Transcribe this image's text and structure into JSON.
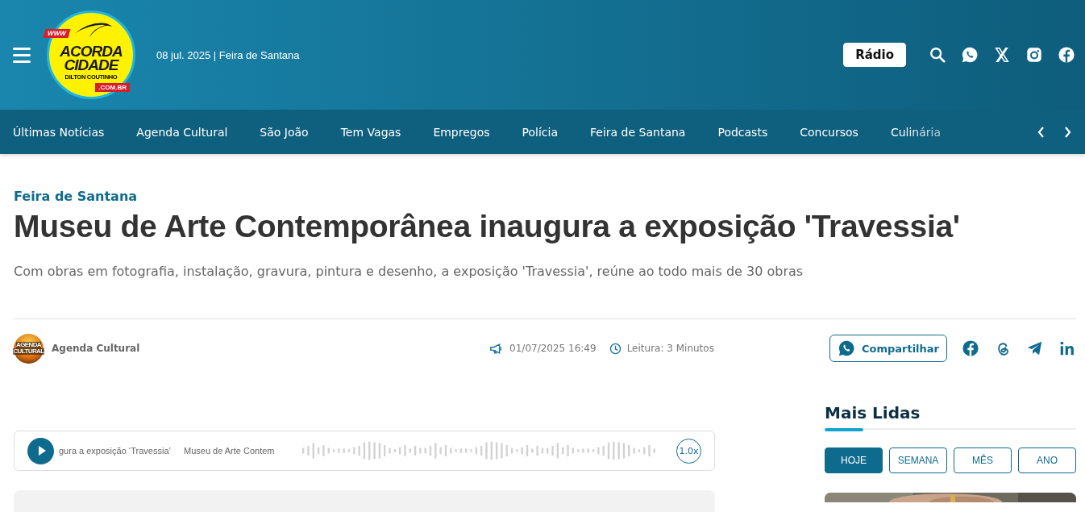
{
  "header": {
    "date_location": "08 jul. 2025 | Feira de Santana",
    "radio_button": {
      "label": "Rádio",
      "highlighted": true
    },
    "logo": {
      "www": "WWW",
      "line_1": "ACORDA",
      "line_2": "CIDADE",
      "subtitle": "DILTON COUTINHO",
      "domain": ".COM.BR"
    }
  },
  "nav": {
    "items": [
      {
        "label": "Últimas Notícias"
      },
      {
        "label": "Agenda Cultural"
      },
      {
        "label": "São João"
      },
      {
        "label": "Tem Vagas"
      },
      {
        "label": "Empregos"
      },
      {
        "label": "Polícia"
      },
      {
        "label": "Feira de Santana"
      },
      {
        "label": "Podcasts"
      },
      {
        "label": "Concursos"
      },
      {
        "label": "Culinária"
      }
    ]
  },
  "article": {
    "category": "Feira de Santana",
    "title": "Museu de Arte Contemporânea inaugura a exposição 'Travessia'",
    "subtitle": "Com obras em fotografia, instalação, gravura, pintura e desenho, a exposição 'Travessia', reúne ao todo mais de 30 obras",
    "author": "Agenda Cultural",
    "author_avatar": {
      "line_1": "AGENDA",
      "line_2": "CULTURAL"
    },
    "published": "01/07/2025 16:49",
    "reading_time": "Leitura: 3 Minutos",
    "share_button": "Compartilhar"
  },
  "audio_player": {
    "ticker": [
      "gura a exposição ‘Travessia’",
      "Museu de Arte Contem"
    ],
    "speed": "1.0x",
    "playing": false
  },
  "sidebar": {
    "title": "Mais Lidas",
    "tabs": [
      {
        "label": "HOJE",
        "selected": true
      },
      {
        "label": "SEMANA",
        "selected": false
      },
      {
        "label": "MÊS",
        "selected": false
      },
      {
        "label": "ANO",
        "selected": false
      }
    ]
  }
}
